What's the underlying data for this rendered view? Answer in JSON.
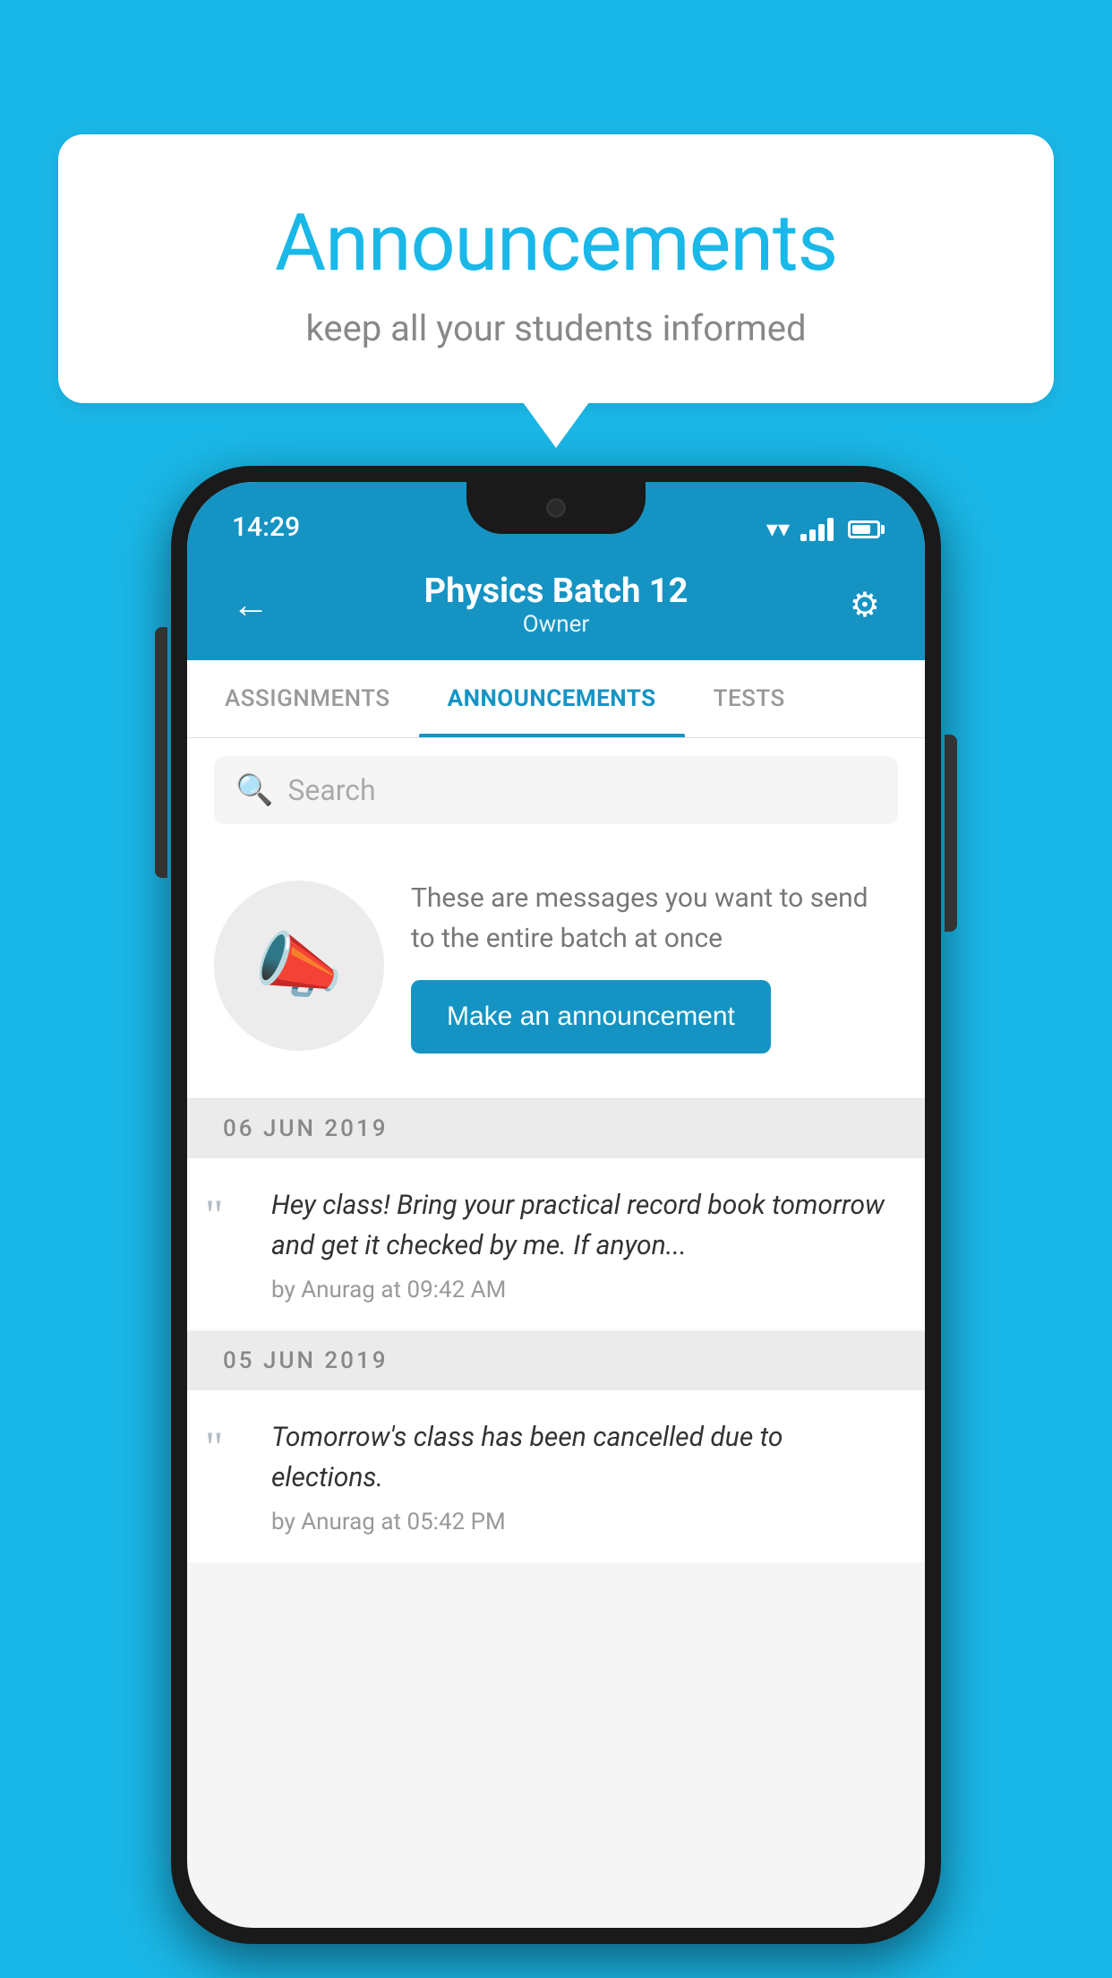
{
  "background_color": "#1ab8e8",
  "speech_bubble": {
    "title": "Announcements",
    "subtitle": "keep all your students informed"
  },
  "status_bar": {
    "time": "14:29"
  },
  "app_header": {
    "title": "Physics Batch 12",
    "subtitle": "Owner",
    "back_label": "←",
    "settings_label": "⚙"
  },
  "tabs": [
    {
      "label": "ASSIGNMENTS",
      "active": false
    },
    {
      "label": "ANNOUNCEMENTS",
      "active": true
    },
    {
      "label": "TESTS",
      "active": false
    }
  ],
  "search": {
    "placeholder": "Search"
  },
  "announcement_prompt": {
    "description": "These are messages you want to send to the entire batch at once",
    "button_label": "Make an announcement"
  },
  "date_groups": [
    {
      "date": "06  JUN  2019",
      "announcements": [
        {
          "text": "Hey class! Bring your practical record book tomorrow and get it checked by me. If anyon...",
          "meta": "by Anurag at 09:42 AM"
        }
      ]
    },
    {
      "date": "05  JUN  2019",
      "announcements": [
        {
          "text": "Tomorrow's class has been cancelled due to elections.",
          "meta": "by Anurag at 05:42 PM"
        }
      ]
    }
  ]
}
